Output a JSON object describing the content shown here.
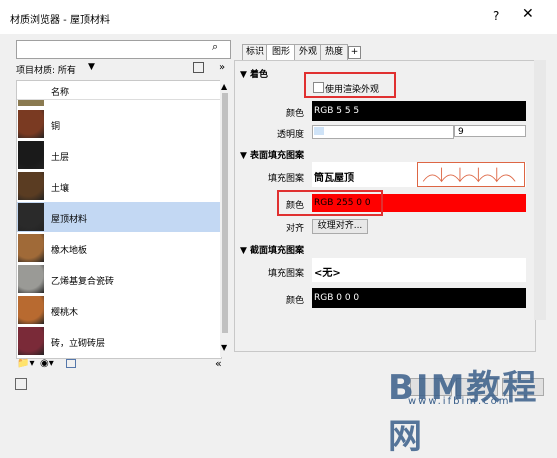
{
  "window": {
    "title": "材质浏览器 - 屋顶材料",
    "help": "?",
    "close": "✕"
  },
  "search": {
    "placeholder": ""
  },
  "filter": {
    "label": "项目材质: 所有",
    "dropdown": "▼"
  },
  "list": {
    "header": "名称",
    "items": [
      {
        "label": "铜",
        "color": "#7a3a22"
      },
      {
        "label": "土层",
        "color": "#1a1a1a"
      },
      {
        "label": "土壤",
        "color": "#5a3c22"
      },
      {
        "label": "屋顶材料",
        "color": "#2a2a2a",
        "selected": true
      },
      {
        "label": "橡木地板",
        "color": "#a06a38"
      },
      {
        "label": "乙烯基复合瓷砖",
        "color": "#9a9a96"
      },
      {
        "label": "樱桃木",
        "color": "#b86a30"
      },
      {
        "label": "砖，立砌砖层",
        "color": "#7a2a38"
      }
    ]
  },
  "tabs": [
    "标识",
    "图形",
    "外观",
    "热度"
  ],
  "tab_add": "+",
  "sections": {
    "shading": {
      "title": "▼ 着色",
      "checkbox_label": "使用渲染外观",
      "color_label": "颜色",
      "color_value": "RGB 5 5 5",
      "transparency_label": "透明度",
      "transparency_value": "9"
    },
    "surface": {
      "title": "▼ 表面填充图案",
      "pattern_label": "填充图案",
      "pattern_value": "筒瓦屋顶",
      "color_label": "颜色",
      "color_value": "RGB 255 0 0",
      "align_label": "对齐",
      "align_button": "纹理对齐..."
    },
    "cut": {
      "title": "▼ 截面填充图案",
      "pattern_label": "填充图案",
      "pattern_value": "<无>",
      "color_label": "颜色",
      "color_value": "RGB 0 0 0"
    }
  },
  "watermark": {
    "text": "BIM教程网",
    "url": "www.ifbim.com"
  },
  "colors": {
    "highlight": "#e03030",
    "selected_row": "#c3d8f3",
    "red_color": "#ff0000"
  }
}
